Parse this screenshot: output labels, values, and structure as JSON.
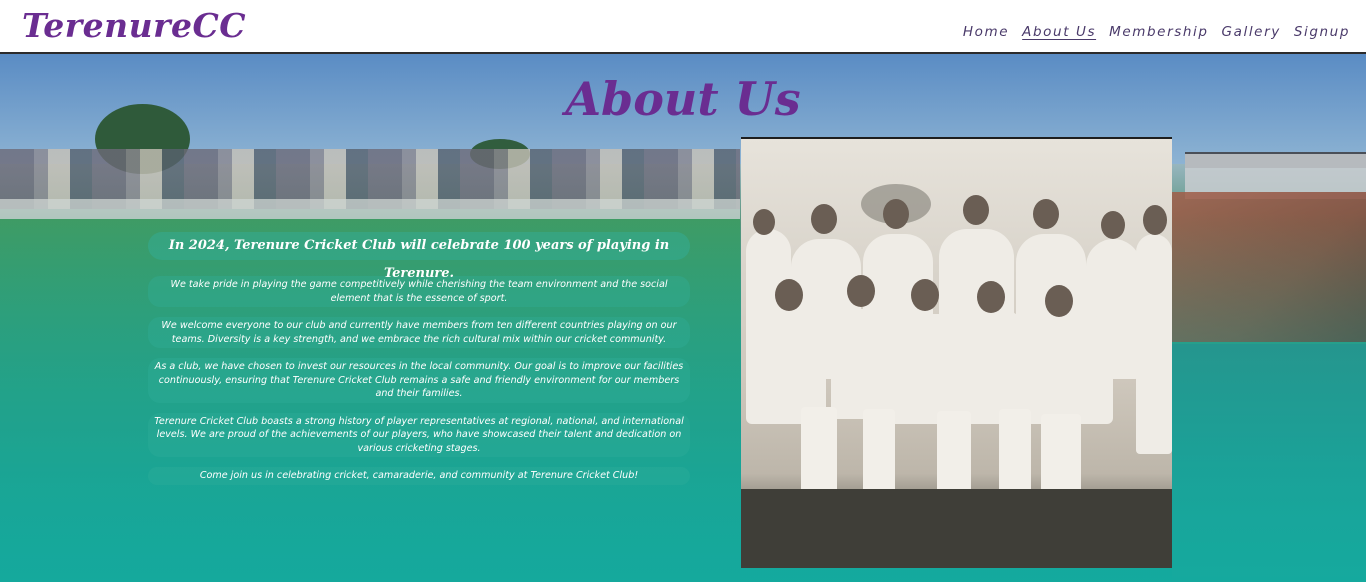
{
  "header": {
    "logo": "TerenureCC",
    "nav": [
      {
        "label": "Home",
        "active": false
      },
      {
        "label": "About Us",
        "active": true
      },
      {
        "label": "Membership",
        "active": false
      },
      {
        "label": "Gallery",
        "active": false
      },
      {
        "label": "Signup",
        "active": false
      }
    ]
  },
  "main": {
    "title": "About Us",
    "intro": "In 2024, Terenure Cricket Club will celebrate 100 years of playing in Terenure.",
    "paragraphs": [
      "We take pride in playing the game competitively while cherishing the team environment and the social element that is the essence of sport.",
      "We welcome everyone to our club and currently have members from ten different countries playing on our teams. Diversity is a key strength, and we embrace the rich cultural mix within our cricket community.",
      "As a club, we have chosen to invest our resources in the local community. Our goal is to improve our facilities continuously, ensuring that Terenure Cricket Club remains a safe and friendly environment for our members and their families.",
      "Terenure Cricket Club boasts a strong history of player representatives at regional, national, and international levels. We are proud of the achievements of our players, who have showcased their talent and dedication on various cricketing stages.",
      "Come join us in celebrating cricket, camaraderie, and community at Terenure Cricket Club!"
    ]
  },
  "colors": {
    "brand": "#6a2d91",
    "teal": "#14a69c",
    "white": "#ffffff"
  }
}
